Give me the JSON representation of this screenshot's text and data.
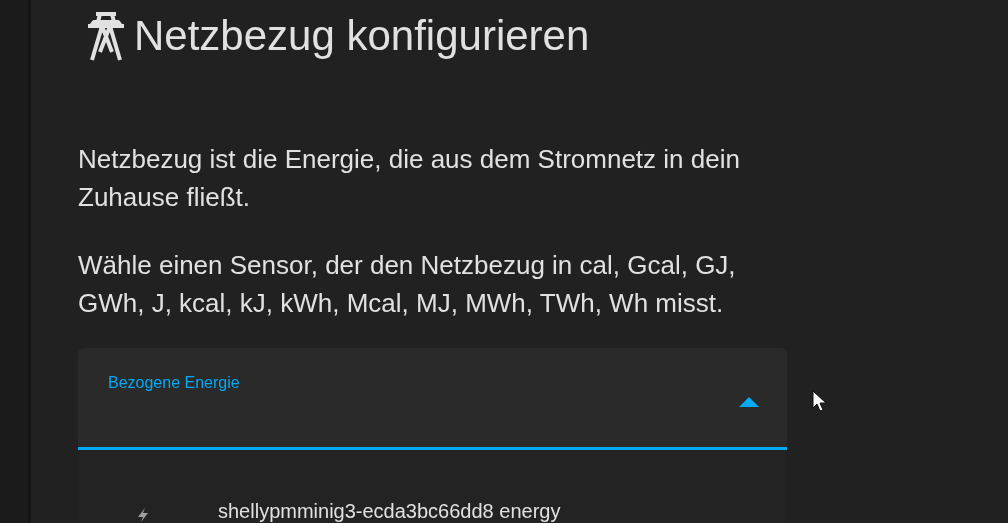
{
  "dialog": {
    "title": "Netzbezug konfigurieren",
    "paragraphs": [
      "Netzbezug ist die Energie, die aus dem Stromnetz in dein Zuhause fließt.",
      "Wähle einen Sensor, der den Netzbezug in cal, Gcal, GJ, GWh, J, kcal, kJ, kWh, Mcal, MJ, MWh, TWh, Wh misst."
    ],
    "select": {
      "label": "Bezogene Energie",
      "expanded": true,
      "options": [
        {
          "label": "shellypmminig3-ecda3bc66dd8 energy"
        }
      ]
    }
  }
}
